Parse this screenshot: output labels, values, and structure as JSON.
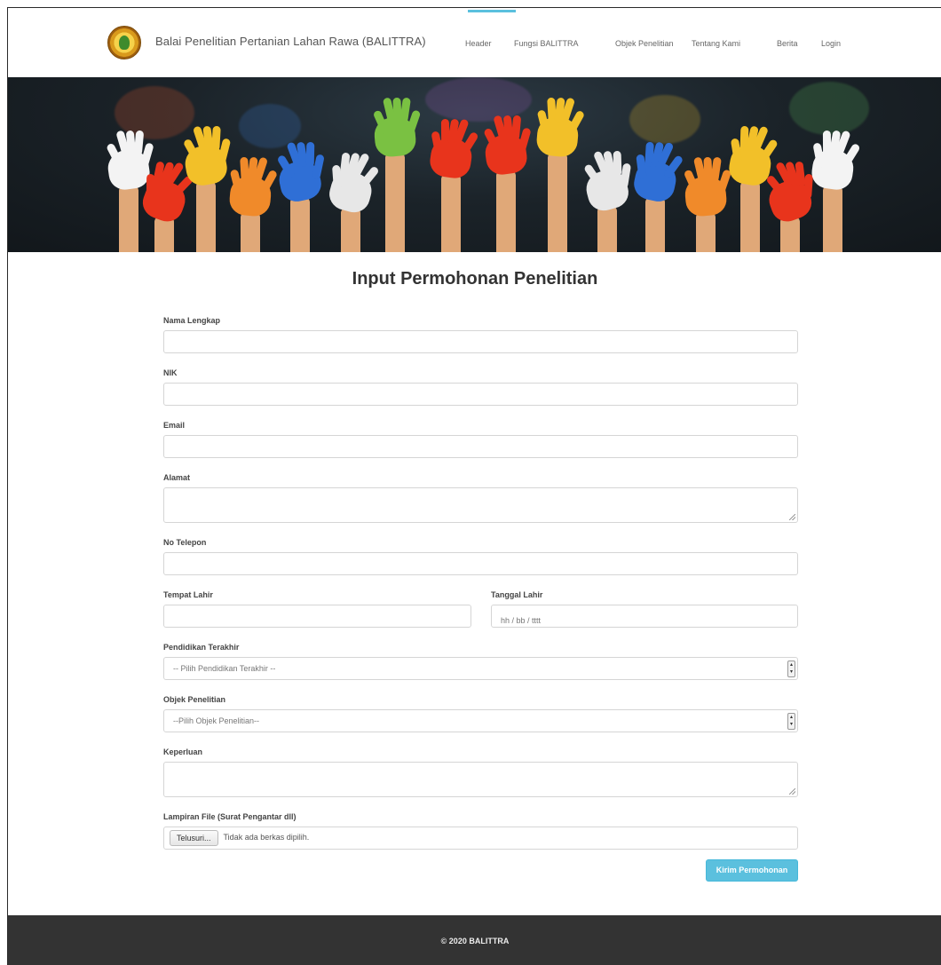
{
  "navbar": {
    "brand": "Balai Penelitian Pertanian Lahan Rawa (BALITTRA)",
    "items": [
      {
        "label": "Header"
      },
      {
        "label": "Fungsi BALITTRA"
      },
      {
        "label": "Objek Penelitian"
      },
      {
        "label": "Tentang Kami"
      },
      {
        "label": "Berita"
      },
      {
        "label": "Login"
      }
    ],
    "accent_color": "#5bc0de"
  },
  "hero": {
    "image": "colorful-painted-hands-banner"
  },
  "form": {
    "title": "Input Permohonan Penelitian",
    "fields": {
      "nama": {
        "label": "Nama Lengkap",
        "value": ""
      },
      "nik": {
        "label": "NIK",
        "value": ""
      },
      "email": {
        "label": "Email",
        "value": ""
      },
      "alamat": {
        "label": "Alamat",
        "value": ""
      },
      "telepon": {
        "label": "No Telepon",
        "value": ""
      },
      "tempat_lahir": {
        "label": "Tempat Lahir",
        "value": ""
      },
      "tanggal_lahir": {
        "label": "Tanggal Lahir",
        "placeholder": "hh / bb / tttt"
      },
      "pendidikan": {
        "label": "Pendidikan Terakhir",
        "selected": "-- Pilih Pendidikan Terakhir --"
      },
      "objek": {
        "label": "Objek Penelitian",
        "selected": "--Pilih Objek Penelitian--"
      },
      "keperluan": {
        "label": "Keperluan",
        "value": ""
      },
      "lampiran": {
        "label": "Lampiran File (Surat Pengantar dll)",
        "button": "Telusuri...",
        "status": "Tidak ada berkas dipilih."
      }
    },
    "submit_label": "Kirim Permohonan",
    "submit_color": "#5bc0de"
  },
  "footer": {
    "text": "© 2020 BALITTRA"
  }
}
